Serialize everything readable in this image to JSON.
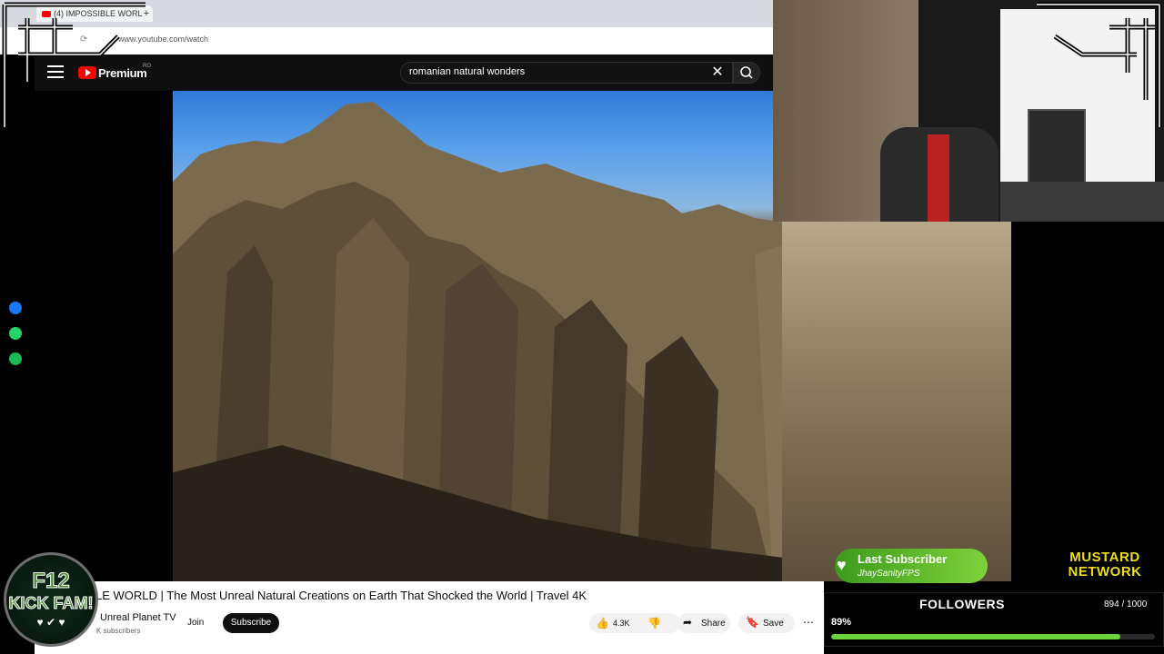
{
  "browser": {
    "tab_title": "(4) IMPOSSIBLE WORL",
    "new_tab": "+",
    "url": "www.youtube.com/watch"
  },
  "youtube": {
    "logo_text": "Premium",
    "region": "RO",
    "search_query": "romanian natural wonders",
    "clear_icon": "close-icon",
    "search_icon": "search-icon"
  },
  "video": {
    "title": "LE WORLD | The Most Unreal Natural Creations on Earth That Shocked the World | Travel 4K",
    "channel": "Unreal Planet TV",
    "subscribers": "K subscribers",
    "join_label": "Join",
    "subscribe_label": "Subscribe",
    "likes": "4.3K",
    "share_label": "Share",
    "save_label": "Save"
  },
  "overlay": {
    "badge_line1": "F12",
    "badge_line2": "KICK FAM!",
    "badge_hearts": "♥ ✔ ♥",
    "last_subscriber_title": "Last Subscriber",
    "last_subscriber_name": "JhaySanityFPS",
    "mustard_line1": "MUSTARD",
    "mustard_line2": "NETWORK",
    "followers_label": "FOLLOWERS",
    "followers_count": "894 / 1000",
    "followers_percent": "89%",
    "followers_progress": 0.894,
    "followers_color": "#6bd43a"
  },
  "side_icons": [
    {
      "name": "messenger-icon",
      "color": "#1877f2"
    },
    {
      "name": "whatsapp-icon",
      "color": "#25d366"
    },
    {
      "name": "spotify-icon",
      "color": "#1db954"
    }
  ]
}
